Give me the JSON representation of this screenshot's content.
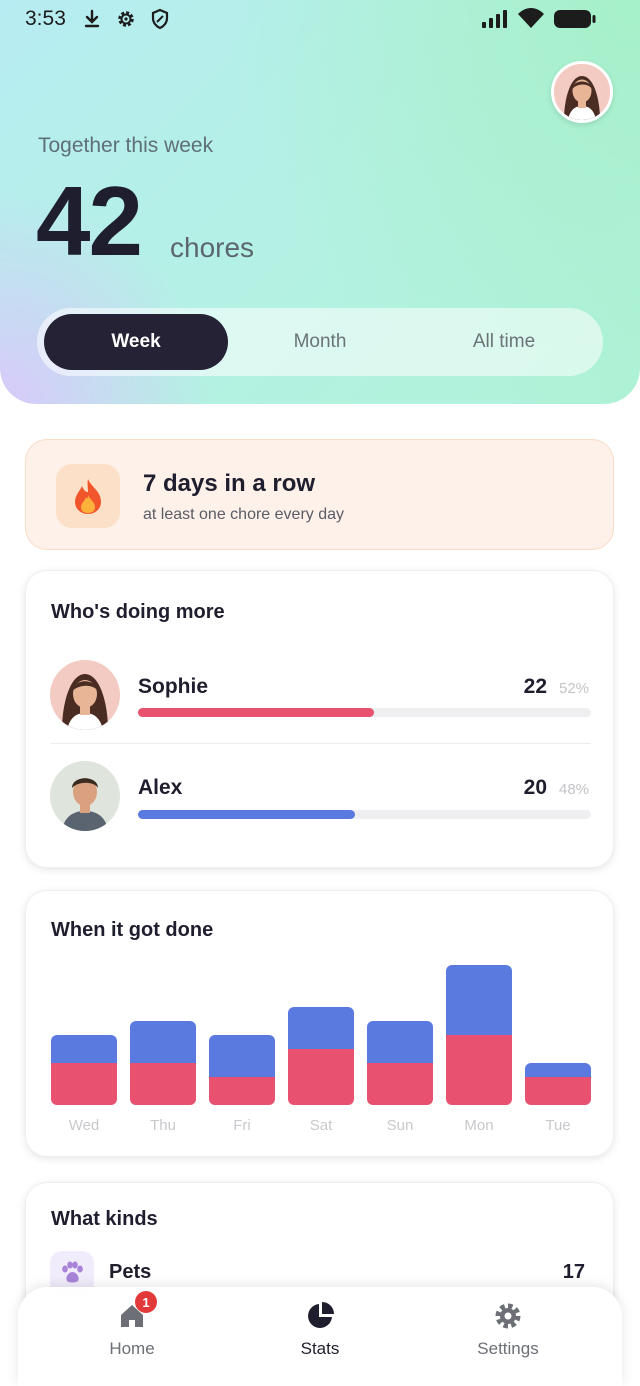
{
  "status_bar": {
    "time": "3:53",
    "left_icons": [
      "download-icon",
      "gear-icon",
      "shield-icon"
    ],
    "right_icons": [
      "signal-icon",
      "wifi-icon",
      "battery-icon"
    ]
  },
  "header": {
    "label": "Together this week",
    "count": "42",
    "unit": "chores",
    "periods": [
      "Week",
      "Month",
      "All time"
    ],
    "selected_period": "Week"
  },
  "streak": {
    "icon": "fire-icon",
    "title": "7 days in a row",
    "subtitle": "at least one chore every day"
  },
  "who": {
    "title": "Who's doing more",
    "people": [
      {
        "name": "Sophie",
        "count": "22",
        "percent": "52%",
        "share": 0.52,
        "color": "#e8516f"
      },
      {
        "name": "Alex",
        "count": "20",
        "percent": "48%",
        "share": 0.48,
        "color": "#5b7ae0"
      }
    ]
  },
  "when": {
    "title": "When it got done"
  },
  "chart_data": {
    "type": "bar",
    "stacked": true,
    "categories": [
      "Wed",
      "Thu",
      "Fri",
      "Sat",
      "Sun",
      "Mon",
      "Tue"
    ],
    "series": [
      {
        "name": "Sophie",
        "color": "#e8516f",
        "values": [
          3,
          3,
          2,
          4,
          3,
          5,
          2
        ]
      },
      {
        "name": "Alex",
        "color": "#5b7ae0",
        "values": [
          2,
          3,
          3,
          3,
          3,
          5,
          1
        ]
      }
    ],
    "title": "When it got done",
    "xlabel": "",
    "ylabel": "",
    "grid": false
  },
  "kinds": {
    "title": "What kinds",
    "items": [
      {
        "name": "Pets",
        "count": "17",
        "icon": "paw-icon"
      }
    ]
  },
  "bottom_nav": {
    "items": [
      {
        "label": "Home",
        "icon": "home-icon",
        "badge": "1"
      },
      {
        "label": "Stats",
        "icon": "pie-chart-icon"
      },
      {
        "label": "Settings",
        "icon": "gear-icon"
      }
    ],
    "active": "Stats"
  }
}
